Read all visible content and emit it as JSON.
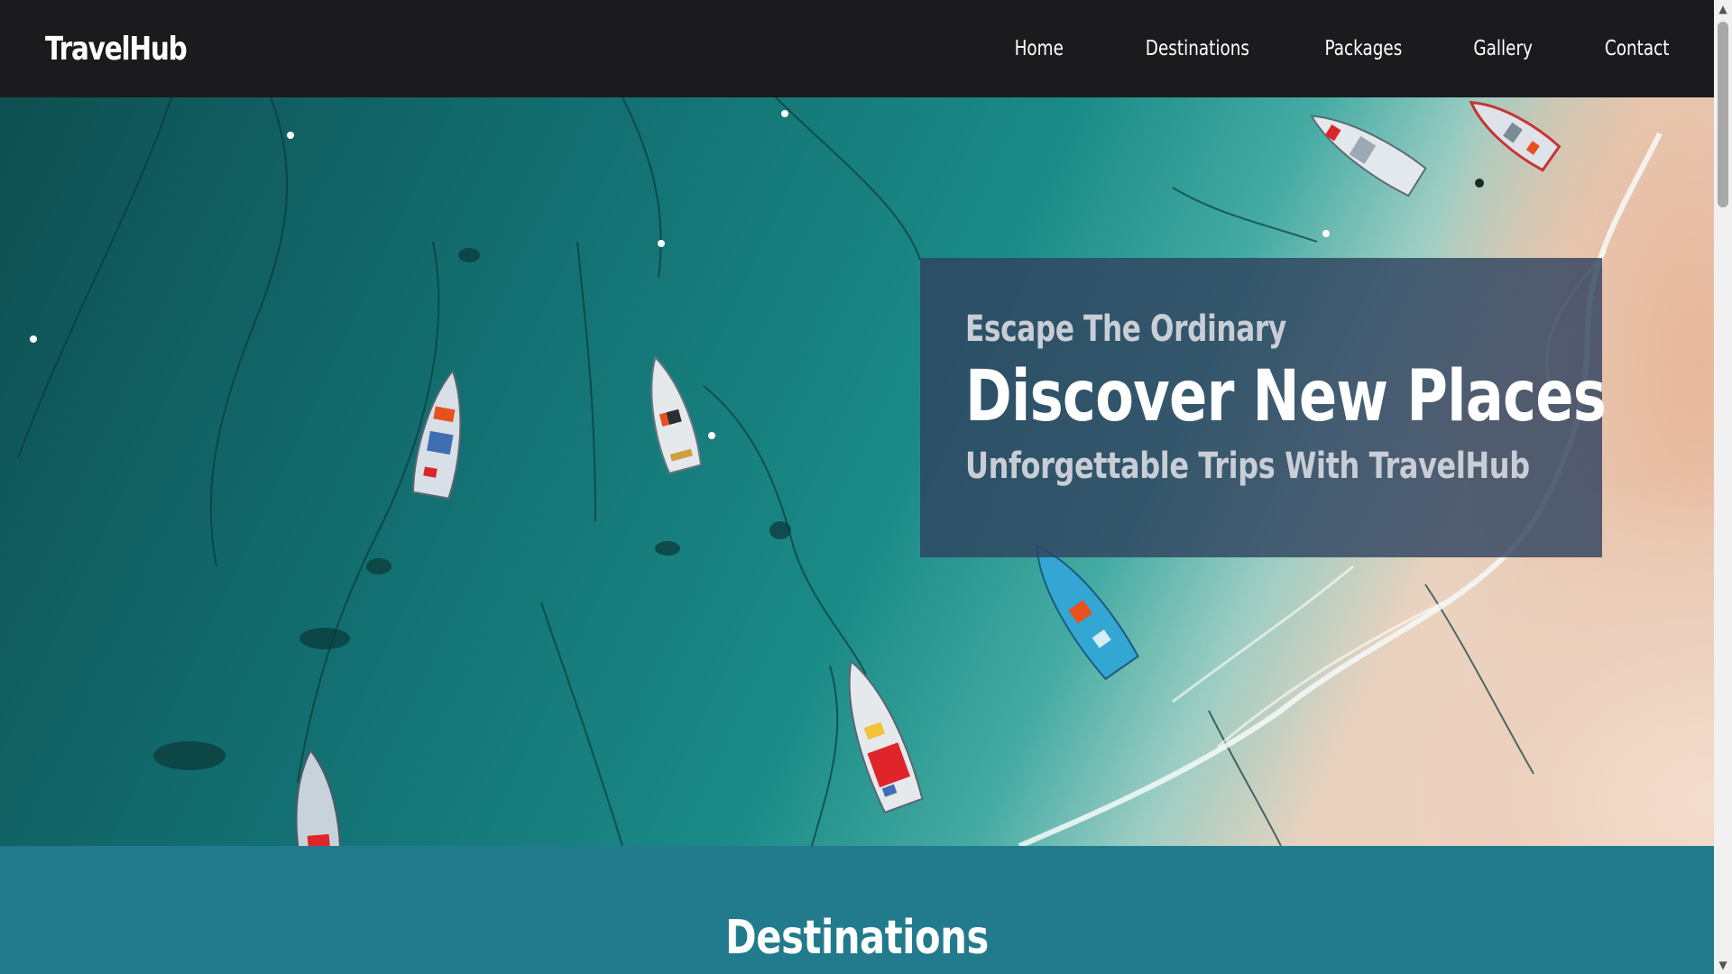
{
  "nav": {
    "brand": "TravelHub",
    "links": [
      "Home",
      "Destinations",
      "Packages",
      "Gallery",
      "Contact"
    ]
  },
  "hero": {
    "kicker": "Escape The Ordinary",
    "title": "Discover New Places",
    "subtitle": "Unforgettable Trips With TravelHub"
  },
  "destinations": {
    "title": "Destinations"
  },
  "scrollbar": {
    "up_icon": "▲",
    "down_icon": "▼"
  },
  "colors": {
    "nav_bg": "#1b1b1e",
    "hero_card_bg": "#2f435f",
    "section_bg": "#227b8c",
    "text_light": "#c9ced6"
  }
}
